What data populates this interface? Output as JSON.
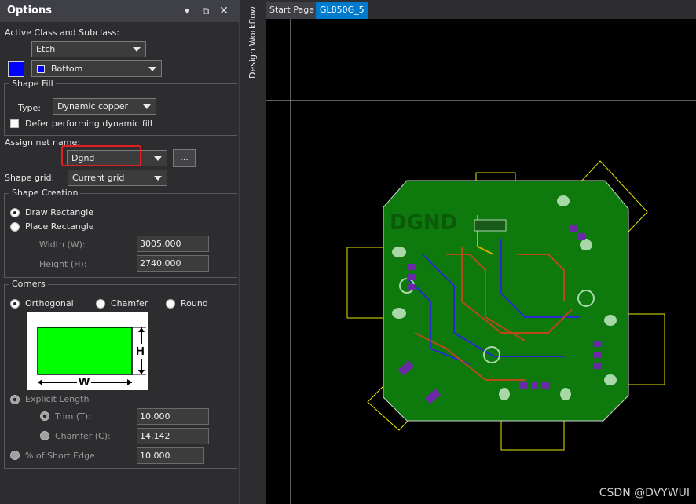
{
  "options": {
    "title": "Options",
    "active_class_label": "Active Class and Subclass:",
    "class_value": "Etch",
    "subclass_value": "Bottom",
    "subclass_color": "#0000ff",
    "shape_fill": {
      "title": "Shape Fill",
      "type_label": "Type:",
      "type_value": "Dynamic copper",
      "defer_label": "Defer performing dynamic fill"
    },
    "assign_net_label": "Assign net name:",
    "net_name_value": "Dgnd",
    "browse_label": "...",
    "shape_grid_label": "Shape grid:",
    "shape_grid_value": "Current grid",
    "shape_creation": {
      "title": "Shape Creation",
      "draw_rect": "Draw Rectangle",
      "place_rect": "Place Rectangle",
      "width_label": "Width (W):",
      "width_value": "3005.000",
      "height_label": "Height (H):",
      "height_value": "2740.000"
    },
    "corners": {
      "title": "Corners",
      "orthogonal": "Orthogonal",
      "chamfer": "Chamfer",
      "round": "Round",
      "diagram_w": "W",
      "diagram_h": "H",
      "explicit_length": "Explicit Length",
      "trim_label": "Trim (T):",
      "trim_value": "10.000",
      "chamfer_label": "Chamfer (C):",
      "chamfer_value": "14.142",
      "short_edge_label": "% of Short Edge",
      "short_edge_value": "10.000"
    }
  },
  "workflow_label": "Design Workflow",
  "tabs": [
    "Start Page",
    "GL850G_5"
  ],
  "board": {
    "silk_text": "DGND",
    "copper_color": "#0e7a0e"
  },
  "watermark": "CSDN @DVYWUI"
}
